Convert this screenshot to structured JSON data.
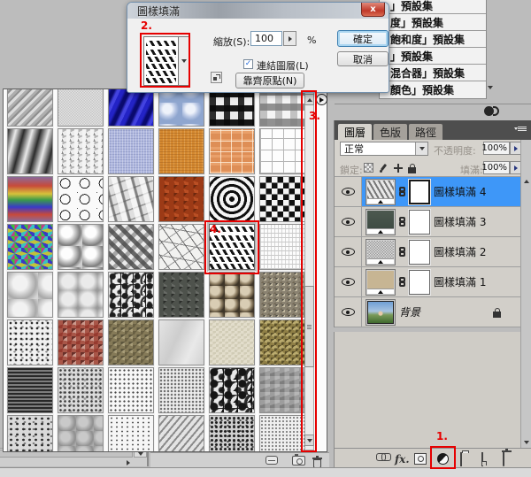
{
  "annotations": {
    "step1": "1.",
    "step2": "2.",
    "step3": "3.",
    "step4": "4."
  },
  "colors": {
    "annotation_red": "#e60000",
    "selected_layer_blue": "#3e97f8",
    "titlebar_close_red": "#c0392a"
  },
  "dialog": {
    "title": "圖樣填滿",
    "close_icon": "x",
    "scale_label": "縮放(S):",
    "scale_value": "100",
    "percent": "%",
    "ok_label": "確定",
    "cancel_label": "取消",
    "link_layers_label": "連結圖層(L)",
    "link_layers_checked": "✓",
    "snap_origin_label": "靠齊原點(N)"
  },
  "preset_menu": {
    "items": [
      "」預設集",
      "度」預設集",
      "飽和度」預設集",
      "」預設集",
      "混合器」預設集",
      "顏色」預設集"
    ]
  },
  "pattern_panel": {
    "selected_swatch": "herringbone",
    "swatches": [
      {
        "name": "diagonal-strokes",
        "tex": "tx-diagonal-strokes"
      },
      {
        "name": "fine-noise",
        "tex": "tx-fine-noise"
      },
      {
        "name": "blue-satin",
        "tex": "tx-blue-satin"
      },
      {
        "name": "blue-bubbles",
        "tex": "tx-blue-bubbles"
      },
      {
        "name": "black-weave",
        "tex": "tx-black-weave"
      },
      {
        "name": "woven-blocks",
        "tex": "tx-woven-blocks"
      },
      {
        "name": "smooth-waves",
        "tex": "tx-smooth-waves"
      },
      {
        "name": "gray-splatter",
        "tex": "tx-gray-splatter"
      },
      {
        "name": "blue-fabric",
        "tex": "tx-blue-fabric"
      },
      {
        "name": "orange-fabric",
        "tex": "tx-orange-fabric"
      },
      {
        "name": "orange-grid",
        "tex": "tx-orange-grid"
      },
      {
        "name": "white-grid",
        "tex": "tx-white-grid"
      },
      {
        "name": "rainbow-stripes",
        "tex": "tx-rainbow-stripes"
      },
      {
        "name": "ink-squiggles",
        "tex": "tx-ink-squiggles"
      },
      {
        "name": "crumpled-gray",
        "tex": "tx-crumpled-gray"
      },
      {
        "name": "rust",
        "tex": "tx-rust"
      },
      {
        "name": "concentric-squares",
        "tex": "tx-concentric-squares"
      },
      {
        "name": "optical-checker",
        "tex": "tx-optical-checker"
      },
      {
        "name": "psychedelic-noise",
        "tex": "tx-psychedelic-noise"
      },
      {
        "name": "soft-clouds",
        "tex": "tx-soft-clouds"
      },
      {
        "name": "zigzag-relief",
        "tex": "tx-zigzag-relief"
      },
      {
        "name": "cracked-plaster",
        "tex": "tx-cracked-plaster"
      },
      {
        "name": "herringbone",
        "tex": "tx-herringbone",
        "selected": true
      },
      {
        "name": "white-mesh",
        "tex": "tx-white-mesh"
      },
      {
        "name": "gray-clouds",
        "tex": "tx-gray-clouds"
      },
      {
        "name": "gray-blobs",
        "tex": "tx-gray-blobs"
      },
      {
        "name": "ink-splotches",
        "tex": "tx-ink-splotches"
      },
      {
        "name": "dark-rock",
        "tex": "tx-dark-rock"
      },
      {
        "name": "pebbles",
        "tex": "tx-pebbles"
      },
      {
        "name": "gravel",
        "tex": "tx-gravel"
      },
      {
        "name": "white-speckle",
        "tex": "tx-white-speckle"
      },
      {
        "name": "red-granite",
        "tex": "tx-red-granite"
      },
      {
        "name": "olive-rock",
        "tex": "tx-olive-rock"
      },
      {
        "name": "light-marble",
        "tex": "tx-light-marble"
      },
      {
        "name": "beige-stone",
        "tex": "tx-beige-stone"
      },
      {
        "name": "gold-gravel",
        "tex": "tx-gold-gravel"
      },
      {
        "name": "dark-strata",
        "tex": "tx-dark-strata"
      },
      {
        "name": "gray-speckle",
        "tex": "tx-gray-speckle"
      },
      {
        "name": "white-speckle-fine",
        "tex": "tx-white-speckle-fine"
      },
      {
        "name": "light-speckle",
        "tex": "tx-light-speckle"
      },
      {
        "name": "bw-camo",
        "tex": "tx-bw-camo"
      },
      {
        "name": "rough-gray",
        "tex": "tx-rough-gray"
      },
      {
        "name": "gray-granite",
        "tex": "tx-gray-granite"
      },
      {
        "name": "soft-gray",
        "tex": "tx-soft-gray"
      },
      {
        "name": "white-noise",
        "tex": "tx-white-noise"
      },
      {
        "name": "gray-strokes",
        "tex": "tx-gray-strokes"
      },
      {
        "name": "dark-speckle",
        "tex": "tx-dark-speckle"
      },
      {
        "name": "light-noise",
        "tex": "tx-light-noise"
      }
    ]
  },
  "layers_panel": {
    "tabs": [
      "圖層",
      "色版",
      "路徑"
    ],
    "blend_mode": "正常",
    "opacity_label": "不透明度:",
    "opacity_value": "100%",
    "lock_label": "鎖定:",
    "fill_label": "填滿:",
    "fill_value": "100%",
    "layers": [
      {
        "name": "圖樣填滿 4",
        "type": "fill",
        "thumb": "t-pat4",
        "mask": true,
        "selected": true
      },
      {
        "name": "圖樣填滿 3",
        "type": "fill",
        "thumb": "t-pat3",
        "mask": true
      },
      {
        "name": "圖樣填滿 2",
        "type": "fill",
        "thumb": "t-pat2",
        "mask": true
      },
      {
        "name": "圖樣填滿 1",
        "type": "fill",
        "thumb": "t-pat1",
        "mask": true
      },
      {
        "name": "背景",
        "type": "image",
        "thumb": "t-photo",
        "italic": true,
        "locked": true
      }
    ]
  },
  "icons": {
    "eye": "visibility",
    "chain": "mask-link",
    "padlock": "locked",
    "fx": "fx.",
    "half_circle": "new-adjustment-or-fill-layer",
    "trash": "delete",
    "folder": "new-group",
    "new_layer": "new-layer",
    "adjustment_circles": "adjustments-panel"
  }
}
